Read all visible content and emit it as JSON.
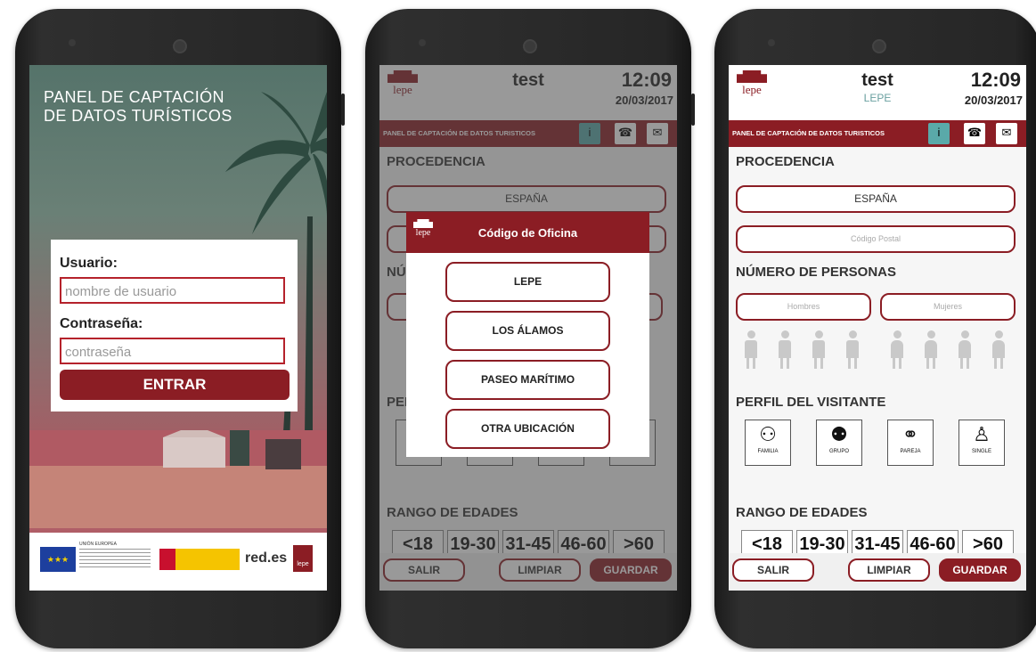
{
  "phone1": {
    "title_line1": "PANEL DE CAPTACIÓN",
    "title_line2": "DE DATOS TURÍSTICOS",
    "user_label": "Usuario:",
    "user_placeholder": "nombre de usuario",
    "password_label": "Contraseña:",
    "password_placeholder": "contraseña",
    "enter_button": "ENTRAR",
    "logos": {
      "eu": "UNIÓN EUROPEA",
      "redes": "red.es",
      "lepe": "lepe"
    }
  },
  "app": {
    "logo_text": "lepe",
    "app_title": "test",
    "time": "12:09",
    "date": "20/03/2017",
    "bar_title": "PANEL DE CAPTACIÓN DE DATOS TURISTICOS",
    "bar_icons": [
      "info-icon",
      "phone-icon",
      "mail-icon"
    ],
    "bar_icon_labels": [
      "i",
      "☎",
      "✉"
    ],
    "section_origin": "PROCEDENCIA",
    "country": "ESPAÑA",
    "postal_placeholder": "Código Postal",
    "section_people": "NÚMERO DE PERSONAS",
    "men_placeholder": "Hombres",
    "women_placeholder": "Mujeres",
    "section_profile": "PERFIL DEL VISITANTE",
    "profiles": [
      "FAMILIA",
      "GRUPO",
      "PAREJA",
      "SINGLE"
    ],
    "section_ages": "RANGO DE EDADES",
    "ages": [
      "<18",
      "19-30",
      "31-45",
      "46-60",
      ">60"
    ],
    "exit_button": "SALIR",
    "clear_button": "LIMPIAR",
    "save_button": "GUARDAR"
  },
  "phone2": {
    "modal_title": "Código de Oficina",
    "options": [
      "LEPE",
      "LOS ÁLAMOS",
      "PASEO MARÍTIMO",
      "OTRA UBICACIÓN"
    ]
  },
  "phone3": {
    "subtitle": "LEPE"
  }
}
